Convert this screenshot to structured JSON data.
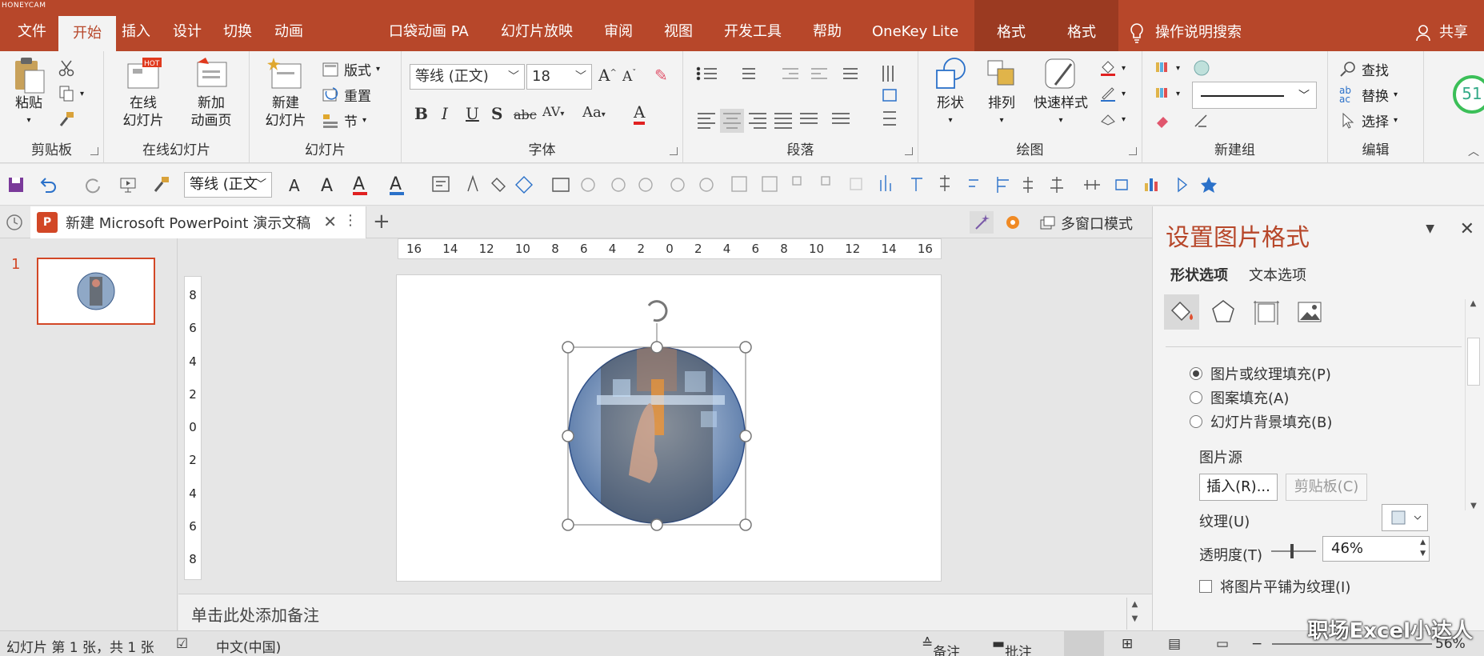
{
  "watermark_top": "HONEYCAM",
  "tabs": [
    {
      "label": "文件"
    },
    {
      "label": "开始"
    },
    {
      "label": "插入"
    },
    {
      "label": "设计"
    },
    {
      "label": "切换"
    },
    {
      "label": "动画"
    },
    {
      "label": "口袋动画 PA"
    },
    {
      "label": "幻灯片放映"
    },
    {
      "label": "审阅"
    },
    {
      "label": "视图"
    },
    {
      "label": "开发工具"
    },
    {
      "label": "帮助"
    },
    {
      "label": "OneKey Lite"
    },
    {
      "label": "格式"
    },
    {
      "label": "格式"
    }
  ],
  "tell_me": "操作说明搜索",
  "share": "共享",
  "ribbon": {
    "clipboard": {
      "paste": "粘贴",
      "label": "剪贴板"
    },
    "online": {
      "online_slide": "在线",
      "online_slide2": "幻灯片",
      "new_anim": "新加",
      "new_anim2": "动画页",
      "label": "在线幻灯片",
      "hot": "HOT"
    },
    "slides": {
      "new_slide": "新建",
      "new_slide2": "幻灯片",
      "layout": "版式",
      "reset": "重置",
      "section": "节",
      "label": "幻灯片"
    },
    "font": {
      "name": "等线 (正文)",
      "size": "18",
      "label": "字体"
    },
    "paragraph": {
      "label": "段落"
    },
    "drawing": {
      "shape": "形状",
      "arrange": "排列",
      "quick_style": "快速样式",
      "label": "绘图"
    },
    "newgroup": {
      "label": "新建组"
    },
    "editing": {
      "find": "查找",
      "replace": "替换",
      "select": "选择",
      "label": "编辑"
    }
  },
  "qat": {
    "font": "等线 (正文"
  },
  "document": {
    "tab_title": "新建 Microsoft  PowerPoint 演示文稿",
    "multi_window": "多窗口模式"
  },
  "thumbs": {
    "slide_number": "1"
  },
  "ruler": {
    "h_ticks": [
      "16",
      "14",
      "12",
      "10",
      "8",
      "6",
      "4",
      "2",
      "0",
      "2",
      "4",
      "6",
      "8",
      "10",
      "12",
      "14",
      "16"
    ],
    "v_ticks": [
      "8",
      "6",
      "4",
      "2",
      "0",
      "2",
      "4",
      "6",
      "8"
    ]
  },
  "notes": {
    "placeholder": "单击此处添加备注"
  },
  "pane": {
    "title": "设置图片格式",
    "tab_shape": "形状选项",
    "tab_text": "文本选项",
    "fill_picture": "图片或纹理填充(P)",
    "fill_pattern": "图案填充(A)",
    "fill_background": "幻灯片背景填充(B)",
    "picture_source": "图片源",
    "insert_btn": "插入(R)...",
    "clipboard_btn": "剪贴板(C)",
    "texture": "纹理(U)",
    "transparency": "透明度(T)",
    "transparency_value": "46%",
    "transparency_pct": 0.46,
    "tile": "将图片平铺为纹理(I)"
  },
  "status": {
    "slide_info": "幻灯片 第 1 张，共 1 张",
    "language": "中文(中国)",
    "notes": "备注",
    "comments": "批注",
    "zoom": "56%"
  },
  "perf_badge": "51",
  "watermark": "职场Excel小达人",
  "colors": {
    "accent": "#b7472a",
    "ppt": "#d24726"
  }
}
